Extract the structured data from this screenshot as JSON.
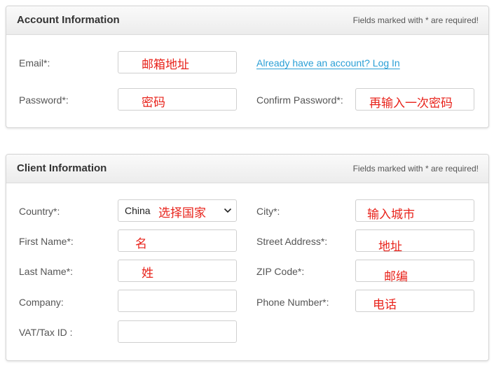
{
  "account": {
    "title": "Account Information",
    "required_note": "Fields marked with * are required!",
    "email_label": "Email*:",
    "email_value": "邮箱地址",
    "login_link": "Already have an account? Log In",
    "password_label": "Password*:",
    "password_value": "密码",
    "confirm_label": "Confirm Password*:",
    "confirm_value": "再输入一次密码"
  },
  "client": {
    "title": "Client Information",
    "required_note": "Fields marked with * are required!",
    "country_label": "Country*:",
    "country_selected": "China",
    "country_annotation": "选择国家",
    "city_label": "City*:",
    "city_value": "输入城市",
    "first_name_label": "First Name*:",
    "first_name_value": "名",
    "street_label": "Street Address*:",
    "street_value": "地址",
    "last_name_label": "Last Name*:",
    "last_name_value": "姓",
    "zip_label": "ZIP Code*:",
    "zip_value": "邮编",
    "company_label": "Company:",
    "company_value": "",
    "phone_label": "Phone Number*:",
    "phone_value": "电话",
    "vat_label": "VAT/Tax ID :",
    "vat_value": ""
  },
  "colors": {
    "annotation": "#e8231b",
    "link": "#2a9fd6"
  },
  "icons": {
    "select_arrow": "chevron-down-icon"
  }
}
